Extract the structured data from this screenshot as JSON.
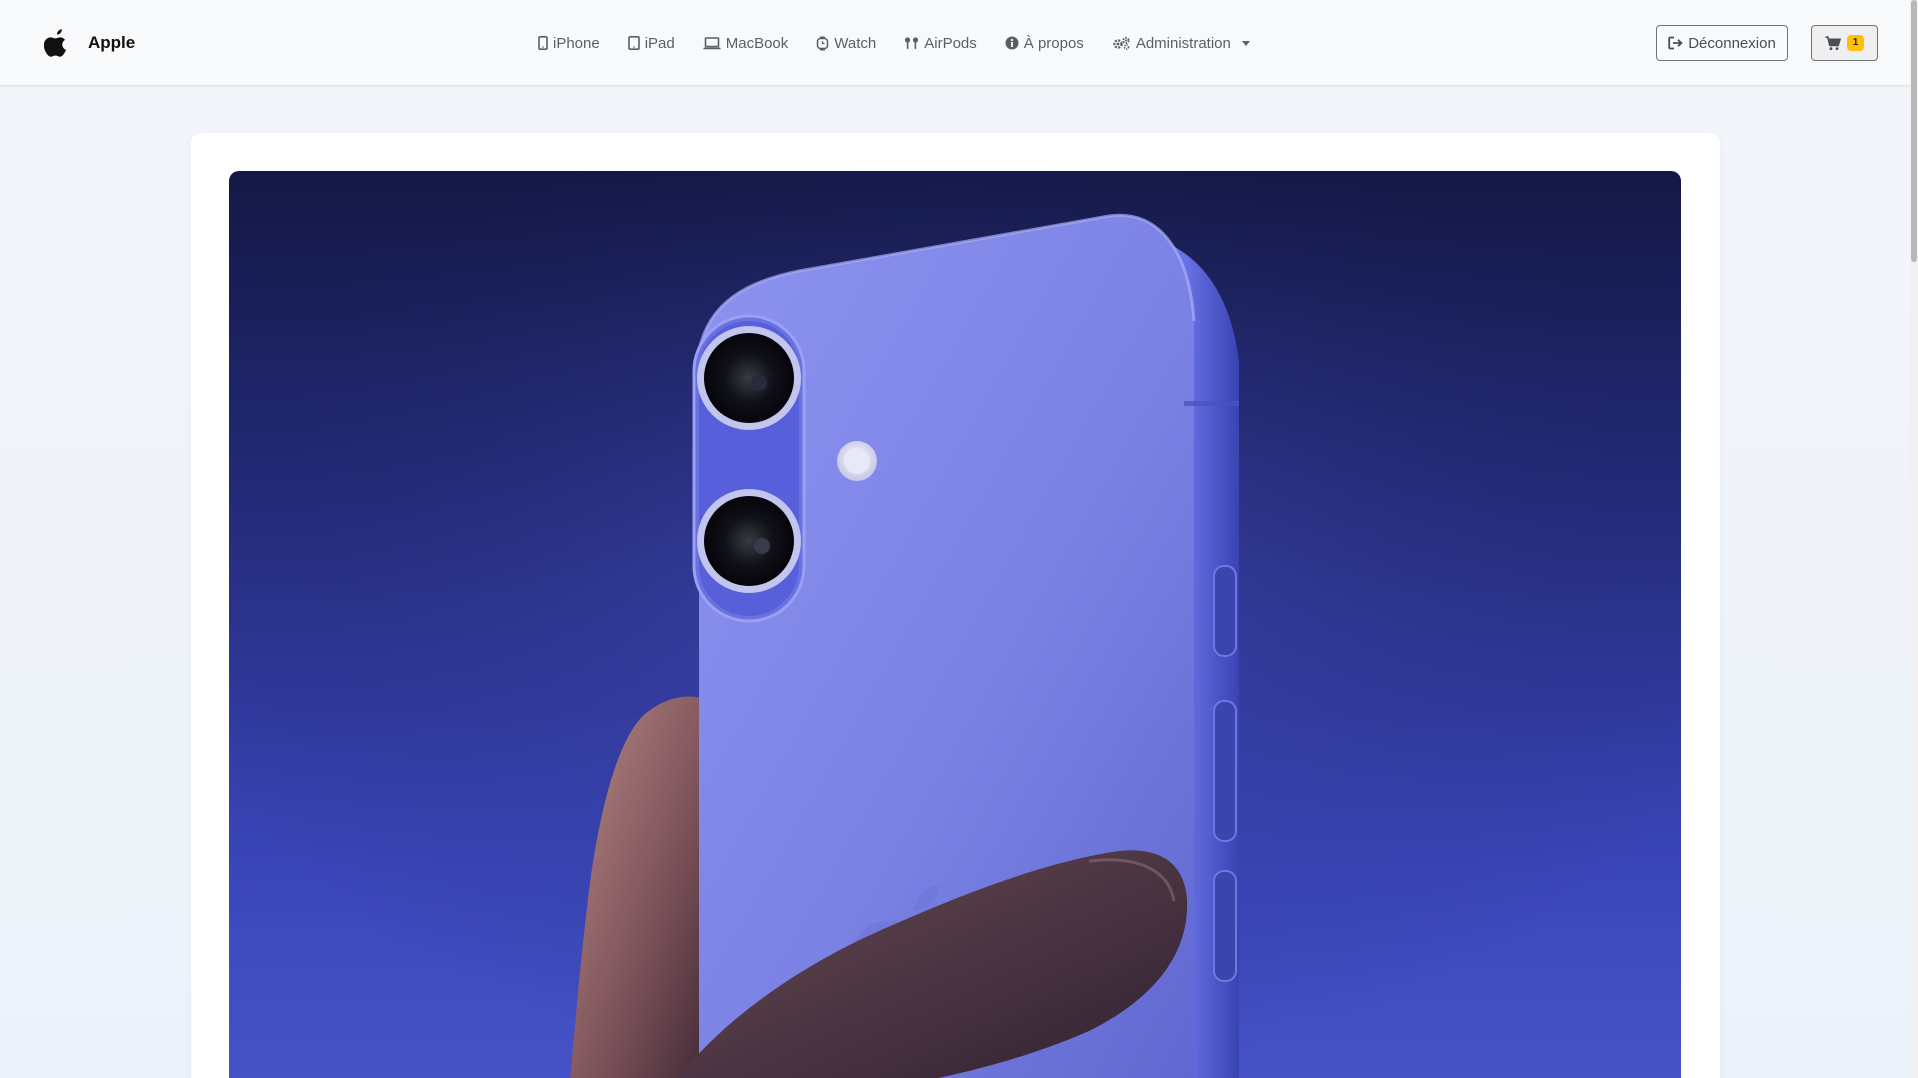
{
  "brand": {
    "name": "Apple"
  },
  "nav": {
    "items": [
      {
        "label": "iPhone",
        "icon": "mobile-icon"
      },
      {
        "label": "iPad",
        "icon": "tablet-icon"
      },
      {
        "label": "MacBook",
        "icon": "laptop-icon"
      },
      {
        "label": "Watch",
        "icon": "clock-icon"
      },
      {
        "label": "AirPods",
        "icon": "earbuds-icon"
      },
      {
        "label": "À propos",
        "icon": "info-icon"
      },
      {
        "label": "Administration",
        "icon": "gears-icon",
        "dropdown": true
      }
    ]
  },
  "actions": {
    "logout_label": "Déconnexion",
    "cart_count": "1"
  },
  "hero": {
    "image": "iPhone held in hand on blue gradient background"
  },
  "colors": {
    "badge": "#ffc107",
    "hero_top": "#141845",
    "hero_bottom": "#4654c8",
    "phone_body": "#7e85e6"
  }
}
